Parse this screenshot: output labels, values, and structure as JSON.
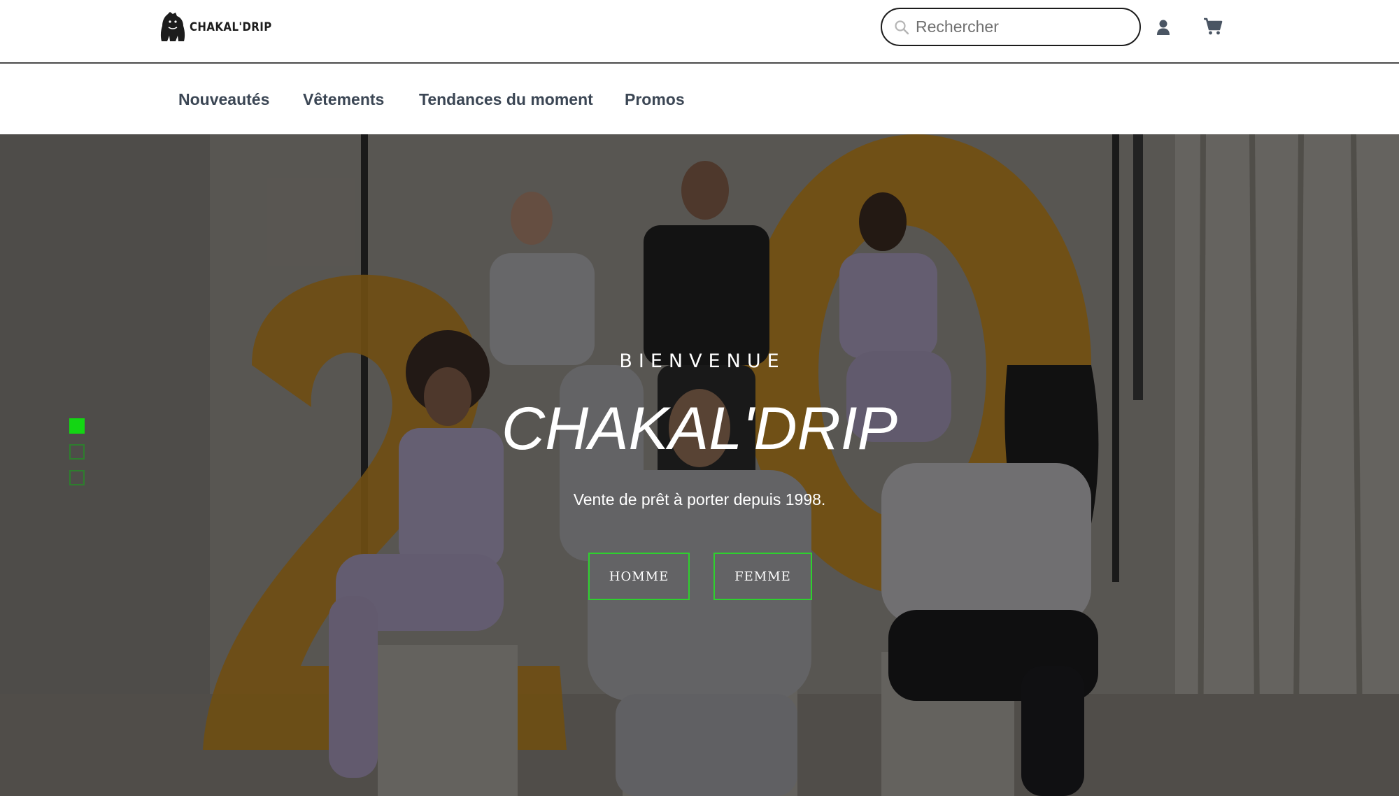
{
  "header": {
    "logo_text": "CHAKAL'DRIP",
    "search_placeholder": "Rechercher",
    "icons": {
      "search": "search-icon",
      "user": "user-icon",
      "cart": "cart-icon"
    }
  },
  "nav": {
    "items": [
      {
        "label": "Nouveautés"
      },
      {
        "label": "Vêtements"
      },
      {
        "label": "Tendances du moment"
      },
      {
        "label": "Promos"
      }
    ]
  },
  "hero": {
    "kicker": "BIENVENUE",
    "title": "CHAKAL'DRIP",
    "subtitle": "Vente de prêt à porter depuis 1998.",
    "buttons": {
      "homme": "HOMME",
      "femme": "FEMME"
    },
    "slides": {
      "count": 3,
      "active_index": 0
    }
  },
  "colors": {
    "accent_green": "#13d613",
    "button_border": "#2ed12e",
    "nav_text": "#3b4654",
    "header_border": "#4a4a4a"
  }
}
